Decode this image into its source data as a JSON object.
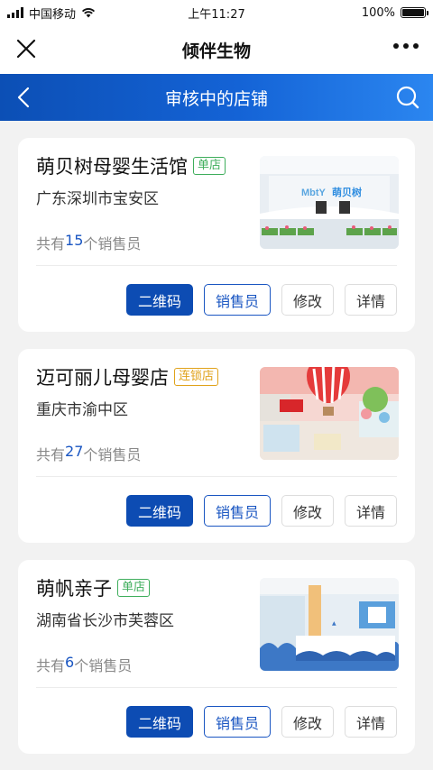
{
  "status_bar": {
    "carrier": "中国移动",
    "time": "上午11:27",
    "battery": "100%"
  },
  "titlebar": {
    "title": "倾伴生物"
  },
  "header": {
    "title": "审核中的店铺"
  },
  "labels": {
    "count_prefix": "共有",
    "count_suffix": "个销售员"
  },
  "buttons": {
    "qr": "二维码",
    "sales": "销售员",
    "edit": "修改",
    "detail": "详情"
  },
  "stores": [
    {
      "name": "萌贝树母婴生活馆",
      "tag": "单店",
      "address": "广东深圳市宝安区",
      "sales_count": "15"
    },
    {
      "name": "迈可丽儿母婴店",
      "tag": "连锁店",
      "address": "重庆市渝中区",
      "sales_count": "27"
    },
    {
      "name": "萌帆亲子",
      "tag": "单店",
      "address": "湖南省长沙市芙蓉区",
      "sales_count": "6"
    }
  ],
  "thumb_texts": {
    "store1_logo": "MbtY 萌贝树"
  },
  "colors": {
    "primary": "#0d4cb3",
    "single_tag": "#3fae5c",
    "chain_tag": "#e0a21a"
  }
}
